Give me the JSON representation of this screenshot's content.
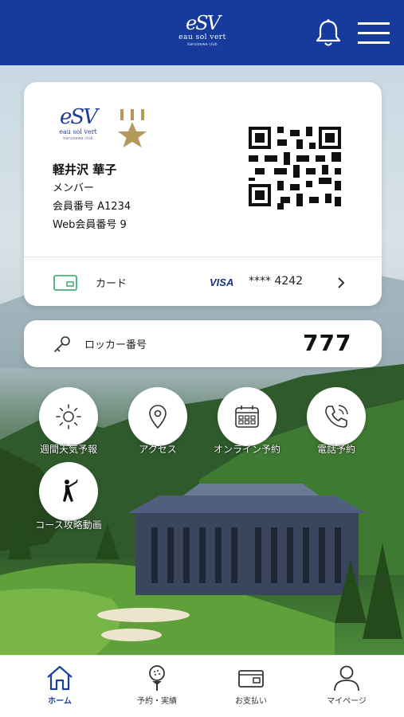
{
  "header": {
    "brand_mono": "eSV",
    "brand_name": "eau sol vert",
    "brand_sub": "karuizawa club",
    "bell_icon": "bell-icon",
    "menu_icon": "hamburger-menu-icon"
  },
  "membership_card": {
    "logo_mono": "eSV",
    "logo_name": "eau sol vert",
    "logo_sub": "karuizawa club",
    "rank_icon": "gold-star-rank-icon",
    "name": "軽井沢 華子",
    "member_type": "メンバー",
    "member_number": "会員番号 A1234",
    "web_member_number": "Web会員番号 9",
    "qr_icon": "qr-code-icon",
    "payment": {
      "label": "カード",
      "brand": "VISA",
      "masked_number": "**** 4242"
    }
  },
  "locker": {
    "label": "ロッカー番号",
    "number": "777"
  },
  "quick_actions": [
    {
      "label": "週間天気予報",
      "icon": "sun-icon"
    },
    {
      "label": "アクセス",
      "icon": "map-pin-icon"
    },
    {
      "label": "オンライン予約",
      "icon": "calendar-icon"
    },
    {
      "label": "電話予約",
      "icon": "phone-icon"
    },
    {
      "label": "コース攻略動画",
      "icon": "golfer-icon"
    }
  ],
  "bottom_nav": [
    {
      "label": "ホーム",
      "icon": "home-icon",
      "active": true
    },
    {
      "label": "予約・実績",
      "icon": "golf-tee-icon",
      "active": false
    },
    {
      "label": "お支払い",
      "icon": "wallet-icon",
      "active": false
    },
    {
      "label": "マイページ",
      "icon": "user-icon",
      "active": false
    }
  ],
  "colors": {
    "header_bg": "#173b9c",
    "active_nav": "#1a3f9c",
    "gold": "#b49a5a"
  }
}
